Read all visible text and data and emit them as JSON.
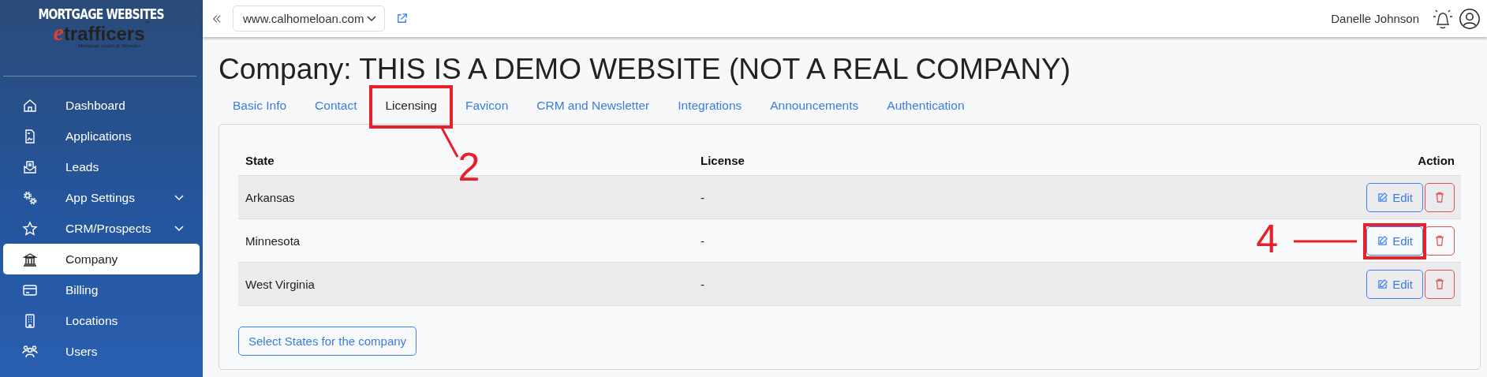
{
  "sidebar": {
    "logo": {
      "line1": "MORTGAGE WEBSITES",
      "brand_initial": "e",
      "brand_rest": "trafficers",
      "brand_mark": "™",
      "tagline": "Mortgage Leads & Websites"
    },
    "items": [
      {
        "label": "Dashboard",
        "selected": false,
        "expandable": false
      },
      {
        "label": "Applications",
        "selected": false,
        "expandable": false
      },
      {
        "label": "Leads",
        "selected": false,
        "expandable": false
      },
      {
        "label": "App Settings",
        "selected": false,
        "expandable": true
      },
      {
        "label": "CRM/Prospects",
        "selected": false,
        "expandable": true
      },
      {
        "label": "Company",
        "selected": true,
        "expandable": false
      },
      {
        "label": "Billing",
        "selected": false,
        "expandable": false
      },
      {
        "label": "Locations",
        "selected": false,
        "expandable": false
      },
      {
        "label": "Users",
        "selected": false,
        "expandable": false
      }
    ]
  },
  "topbar": {
    "site_select": "www.calhomeloan.com",
    "user_name": "Danelle Johnson"
  },
  "page_title": "Company: THIS IS A DEMO WEBSITE (NOT A REAL COMPANY)",
  "tabs": [
    {
      "label": "Basic Info",
      "selected": false
    },
    {
      "label": "Contact",
      "selected": false
    },
    {
      "label": "Licensing",
      "selected": true,
      "callout": "2"
    },
    {
      "label": "Favicon",
      "selected": false
    },
    {
      "label": "CRM and Newsletter",
      "selected": false
    },
    {
      "label": "Integrations",
      "selected": false
    },
    {
      "label": "Announcements",
      "selected": false
    },
    {
      "label": "Authentication",
      "selected": false
    }
  ],
  "table": {
    "columns": [
      "State",
      "License",
      "Action"
    ],
    "rows": [
      {
        "state": "Arkansas",
        "license": "-",
        "edit": "Edit"
      },
      {
        "state": "Minnesota",
        "license": "-",
        "edit": "Edit",
        "callout": "4"
      },
      {
        "state": "West Virginia",
        "license": "-",
        "edit": "Edit"
      }
    ]
  },
  "select_states_button": "Select States for the company"
}
